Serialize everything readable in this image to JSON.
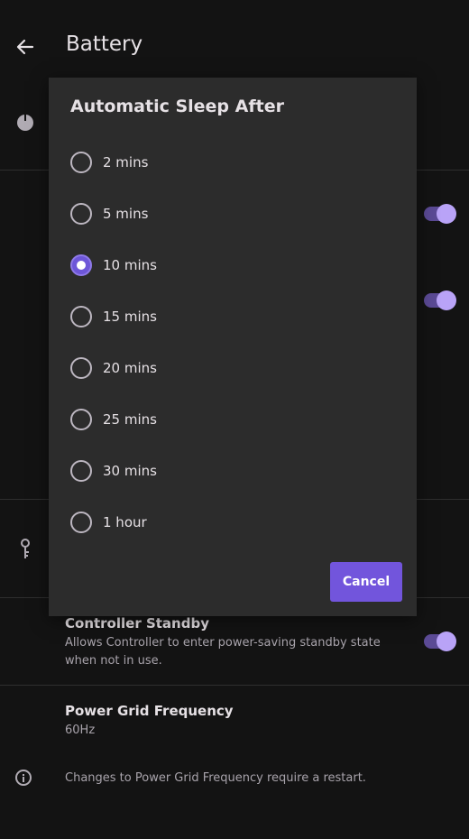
{
  "header": {
    "title": "Battery"
  },
  "settings": {
    "controller_standby": {
      "title": "Controller Standby",
      "subtitle_line1": "Allows Controller to enter power-saving standby state",
      "subtitle_line2": "when not in use."
    },
    "power_grid": {
      "title": "Power Grid Frequency",
      "value": "60Hz"
    },
    "info": "Changes to Power Grid Frequency require a restart."
  },
  "dialog": {
    "title": "Automatic Sleep After",
    "options": [
      {
        "label": "2 mins",
        "selected": false
      },
      {
        "label": "5 mins",
        "selected": false
      },
      {
        "label": "10 mins",
        "selected": true
      },
      {
        "label": "15 mins",
        "selected": false
      },
      {
        "label": "20 mins",
        "selected": false
      },
      {
        "label": "25 mins",
        "selected": false
      },
      {
        "label": "30 mins",
        "selected": false
      },
      {
        "label": "1 hour",
        "selected": false
      }
    ],
    "cancel_label": "Cancel"
  },
  "colors": {
    "accent": "#7255dc",
    "toggle_track": "#5b4a95",
    "toggle_knob": "#b9a3f7",
    "background": "#131313",
    "dialog_bg": "#2c2c2c"
  }
}
